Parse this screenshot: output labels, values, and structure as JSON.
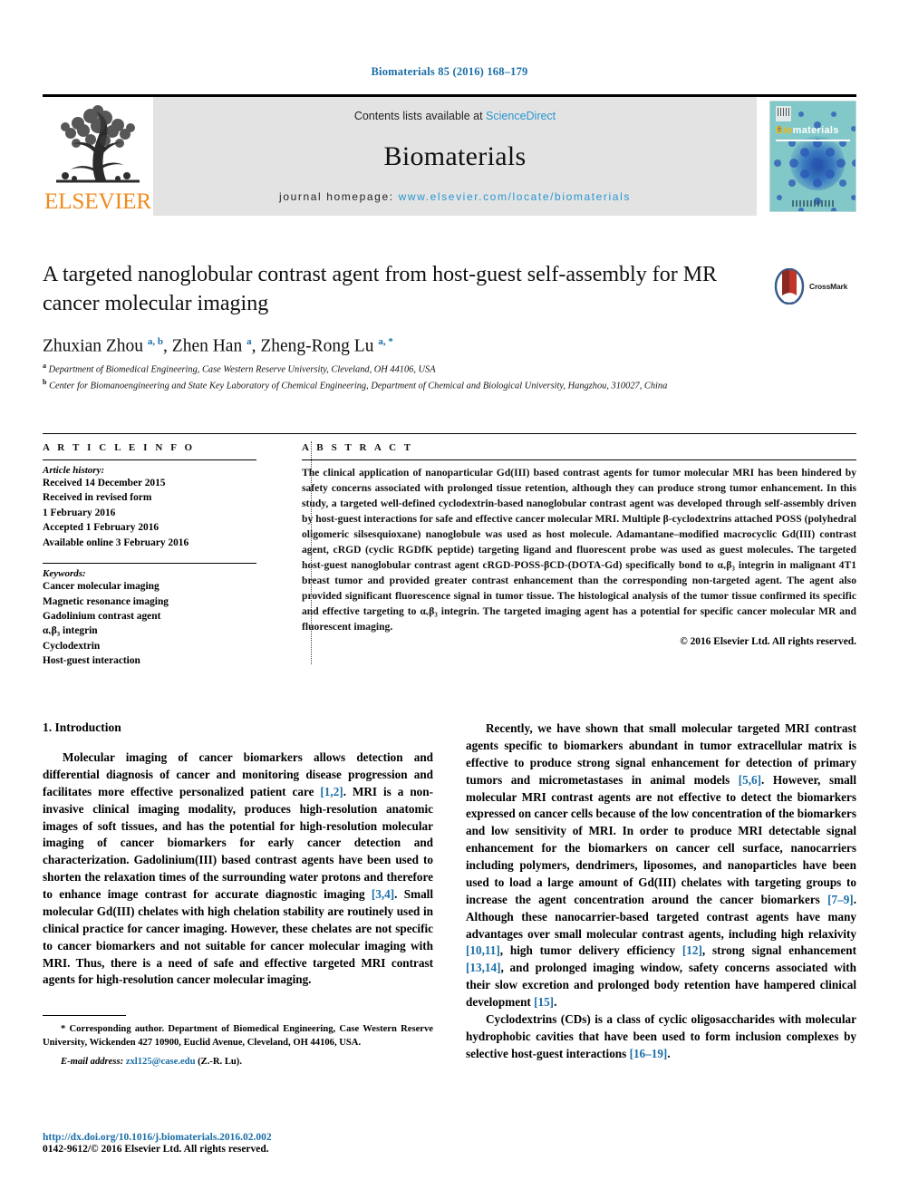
{
  "running_head": "Biomaterials 85 (2016) 168–179",
  "masthead": {
    "publisher_logo_text": "ELSEVIER",
    "contents_prefix": "Contents lists available at ",
    "contents_link": "ScienceDirect",
    "journal_name": "Biomaterials",
    "homepage_prefix": "journal homepage: ",
    "homepage_link": "www.elsevier.com/locate/biomaterials",
    "cover": {
      "title_bio": "Bio",
      "title_materials": "materials"
    },
    "link_color": "#2a96d0",
    "elsevier_orange": "#f08a1c"
  },
  "article": {
    "title": "A targeted nanoglobular contrast agent from host-guest self-assembly for MR cancer molecular imaging",
    "crossmark_label": "CrossMark",
    "authors_html": "Zhuxian Zhou <sup>a, b</sup>, Zhen Han <sup>a</sup>, Zheng-Rong Lu <sup>a, *</sup>",
    "affiliations": [
      "Department of Biomedical Engineering, Case Western Reserve University, Cleveland, OH 44106, USA",
      "Center for Biomanoengineering and State Key Laboratory of Chemical Engineering, Department of Chemical and Biological University, Hangzhou, 310027, China"
    ],
    "affiliation_marks": [
      "a",
      "b"
    ]
  },
  "article_info": {
    "heading": "A R T I C L E  I N F O",
    "history_label": "Article history:",
    "history": [
      "Received 14 December 2015",
      "Received in revised form",
      "1 February 2016",
      "Accepted 1 February 2016",
      "Available online 3 February 2016"
    ],
    "keywords_label": "Keywords:",
    "keywords": [
      "Cancer molecular imaging",
      "Magnetic resonance imaging",
      "Gadolinium contrast agent",
      "αᵥβ₃ integrin",
      "Cyclodextrin",
      "Host-guest interaction"
    ]
  },
  "abstract": {
    "heading": "A B S T R A C T",
    "text": "The clinical application of nanoparticular Gd(III) based contrast agents for tumor molecular MRI has been hindered by safety concerns associated with prolonged tissue retention, although they can produce strong tumor enhancement. In this study, a targeted well-defined cyclodextrin-based nanoglobular contrast agent was developed through self-assembly driven by host-guest interactions for safe and effective cancer molecular MRI. Multiple β-cyclodextrins attached POSS (polyhedral oligomeric silsesquioxane) nanoglobule was used as host molecule. Adamantane–modified macrocyclic Gd(III) contrast agent, cRGD (cyclic RGDfK peptide) targeting ligand and fluorescent probe was used as guest molecules. The targeted host-guest nanoglobular contrast agent cRGD-POSS-βCD-(DOTA-Gd) specifically bond to αᵥβ₃ integrin in malignant 4T1 breast tumor and provided greater contrast enhancement than the corresponding non-targeted agent. The agent also provided significant fluorescence signal in tumor tissue. The histological analysis of the tumor tissue confirmed its specific and effective targeting to αᵥβ₃ integrin. The targeted imaging agent has a potential for specific cancer molecular MR and fluorescent imaging.",
    "copyright": "© 2016 Elsevier Ltd. All rights reserved."
  },
  "body": {
    "section_heading": "1.  Introduction",
    "left_paragraphs": [
      "Molecular imaging of cancer biomarkers allows detection and differential diagnosis of cancer and monitoring disease progression and facilitates more effective personalized patient care [1,2]. MRI is a non-invasive clinical imaging modality, produces high-resolution anatomic images of soft tissues, and has the potential for high-resolution molecular imaging of cancer biomarkers for early cancer detection and characterization. Gadolinium(III) based contrast agents have been used to shorten the relaxation times of the surrounding water protons and therefore to enhance image contrast for accurate diagnostic imaging [3,4]. Small molecular Gd(III) chelates with high chelation stability are routinely used in clinical practice for cancer imaging. However, these chelates are not specific to cancer biomarkers and not suitable for cancer molecular imaging with MRI. Thus, there is a need of safe and effective targeted MRI contrast agents for high-resolution cancer molecular imaging."
    ],
    "right_paragraphs": [
      "Recently, we have shown that small molecular targeted MRI contrast agents specific to biomarkers abundant in tumor extracellular matrix is effective to produce strong signal enhancement for detection of primary tumors and micrometastases in animal models [5,6]. However, small molecular MRI contrast agents are not effective to detect the biomarkers expressed on cancer cells because of the low concentration of the biomarkers and low sensitivity of MRI. In order to produce MRI detectable signal enhancement for the biomarkers on cancer cell surface, nanocarriers including polymers, dendrimers, liposomes, and nanoparticles have been used to load a large amount of Gd(III) chelates with targeting groups to increase the agent concentration around the cancer biomarkers [7–9]. Although these nanocarrier-based targeted contrast agents have many advantages over small molecular contrast agents, including high relaxivity [10,11], high tumor delivery efficiency [12], strong signal enhancement [13,14], and prolonged imaging window, safety concerns associated with their slow excretion and prolonged body retention have hampered clinical development [15].",
      "Cyclodextrins (CDs) is a class of cyclic oligosaccharides with molecular hydrophobic cavities that have been used to form inclusion complexes by selective host-guest interactions [16–19]."
    ]
  },
  "footnotes": {
    "corresponding": "* Corresponding author. Department of Biomedical Engineering, Case Western Reserve University, Wickenden 427 10900, Euclid Avenue, Cleveland, OH 44106, USA.",
    "email_label": "E-mail address:",
    "email": "zxl125@case.edu",
    "email_suffix": "(Z.-R. Lu).",
    "doi": "http://dx.doi.org/10.1016/j.biomaterials.2016.02.002",
    "issn_line": "0142-9612/© 2016 Elsevier Ltd. All rights reserved."
  }
}
